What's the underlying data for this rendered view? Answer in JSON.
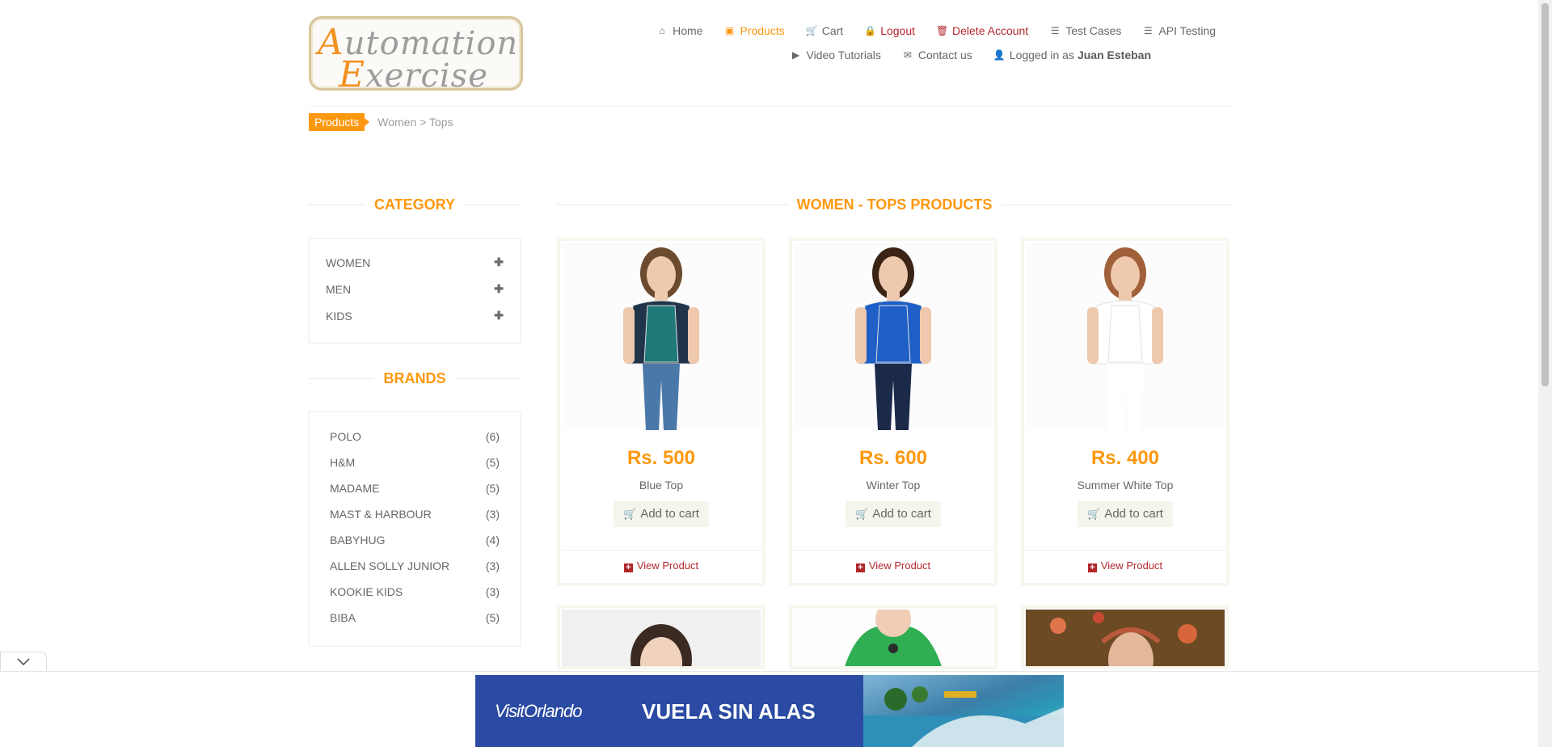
{
  "logo": {
    "line1": "utomation",
    "line1_cap": "A",
    "line2": "xercise",
    "line2_cap": "E"
  },
  "nav": {
    "row1": [
      {
        "name": "nav-home",
        "icon": "home-icon",
        "glyph": "⌂",
        "label": "Home",
        "style": ""
      },
      {
        "name": "nav-products",
        "icon": "shirt-icon",
        "glyph": "▣",
        "label": "Products",
        "style": "active"
      },
      {
        "name": "nav-cart",
        "icon": "cart-icon",
        "glyph": "🛒",
        "label": "Cart",
        "style": ""
      },
      {
        "name": "nav-logout",
        "icon": "lock-icon",
        "glyph": "🔒",
        "label": "Logout",
        "style": "red"
      },
      {
        "name": "nav-delete-account",
        "icon": "trash-icon",
        "glyph": "🗑",
        "label": "Delete Account",
        "style": "red"
      },
      {
        "name": "nav-test-cases",
        "icon": "list-icon",
        "glyph": "☰",
        "label": "Test Cases",
        "style": ""
      },
      {
        "name": "nav-api-testing",
        "icon": "list-icon",
        "glyph": "☰",
        "label": "API Testing",
        "style": ""
      }
    ],
    "row2": [
      {
        "name": "nav-video-tutorials",
        "icon": "youtube-icon",
        "glyph": "▶",
        "label": "Video Tutorials"
      },
      {
        "name": "nav-contact-us",
        "icon": "envelope-icon",
        "glyph": "✉",
        "label": "Contact us"
      }
    ],
    "logged_in_prefix": "Logged in as",
    "logged_in_user": "Juan Esteban"
  },
  "breadcrumb": {
    "active": "Products",
    "path": "Women > Tops"
  },
  "sidebar": {
    "category_title": "CATEGORY",
    "categories": [
      {
        "label": "WOMEN",
        "icon": "plus-icon"
      },
      {
        "label": "MEN",
        "icon": "plus-icon"
      },
      {
        "label": "KIDS",
        "icon": "plus-icon"
      }
    ],
    "brands_title": "BRANDS",
    "brands": [
      {
        "label": "POLO",
        "count": "(6)"
      },
      {
        "label": "H&M",
        "count": "(5)"
      },
      {
        "label": "MADAME",
        "count": "(5)"
      },
      {
        "label": "MAST & HARBOUR",
        "count": "(3)"
      },
      {
        "label": "BABYHUG",
        "count": "(4)"
      },
      {
        "label": "ALLEN SOLLY JUNIOR",
        "count": "(3)"
      },
      {
        "label": "KOOKIE KIDS",
        "count": "(3)"
      },
      {
        "label": "BIBA",
        "count": "(5)"
      }
    ]
  },
  "products": {
    "title": "WOMEN - TOPS PRODUCTS",
    "add_label": "Add to cart",
    "view_label": "View Product",
    "items": [
      {
        "price": "Rs. 500",
        "name": "Blue Top",
        "top_color": "#1f7a78",
        "jacket_color": "#20344a",
        "hair_color": "#6b4a2e",
        "pants_color": "#4a78a8"
      },
      {
        "price": "Rs. 600",
        "name": "Winter Top",
        "top_color": "#1e5fc8",
        "jacket_color": "#1e5fc8",
        "hair_color": "#3b2416",
        "pants_color": "#1c2a4a"
      },
      {
        "price": "Rs. 400",
        "name": "Summer White Top",
        "top_color": "#ffffff",
        "jacket_color": "#ffffff",
        "hair_color": "#a0603a",
        "pants_color": "#ffffff"
      }
    ]
  },
  "ad": {
    "brand": "VisitOrlando",
    "tagline": "VUELA SIN ALAS"
  }
}
